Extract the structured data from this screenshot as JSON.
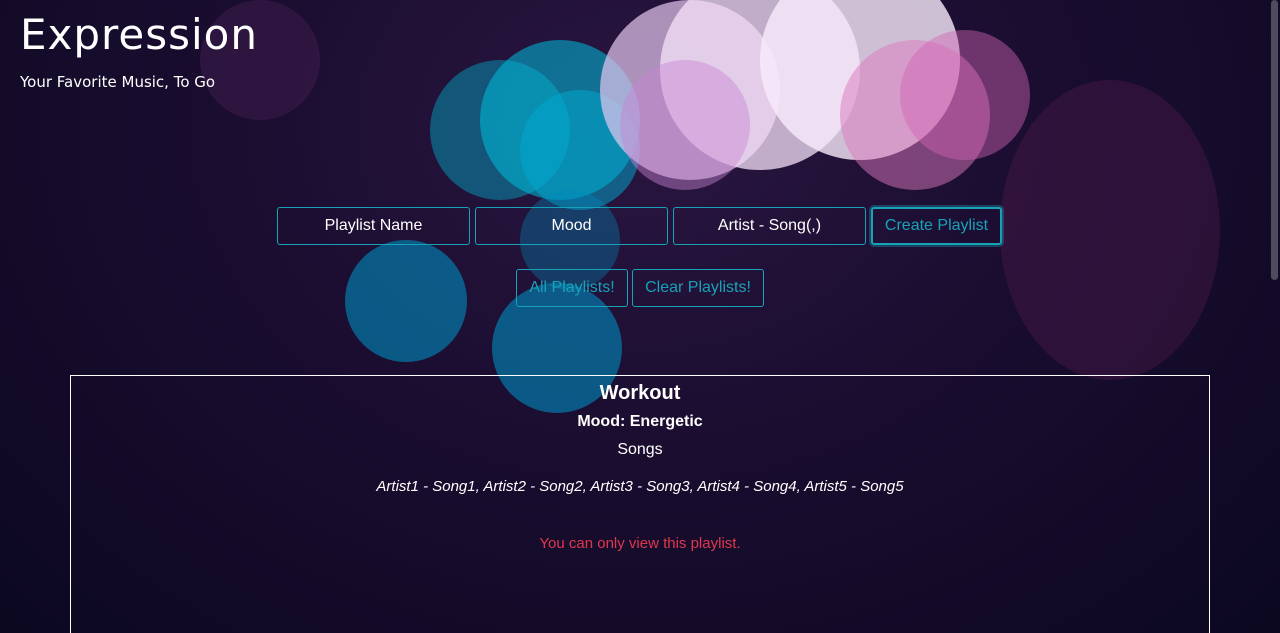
{
  "brand": {
    "title": "Expression",
    "tagline": "Your Favorite Music, To Go"
  },
  "form": {
    "name_placeholder": "Playlist Name",
    "mood_placeholder": "Mood",
    "songs_placeholder": "Artist - Song(,)",
    "create_label": "Create Playlist"
  },
  "actions": {
    "all_label": "All Playlists!",
    "clear_label": "Clear Playlists!"
  },
  "playlist": {
    "name": "Workout",
    "mood": "Mood: Energetic",
    "songs_heading": "Songs",
    "songs": "Artist1 - Song1, Artist2 - Song2, Artist3 - Song3, Artist4 - Song4, Artist5 - Song5",
    "notice": "You can only view this playlist."
  },
  "colors": {
    "accent": "#17a2b8",
    "notice": "#e0364e",
    "background": "#1a0d30"
  }
}
